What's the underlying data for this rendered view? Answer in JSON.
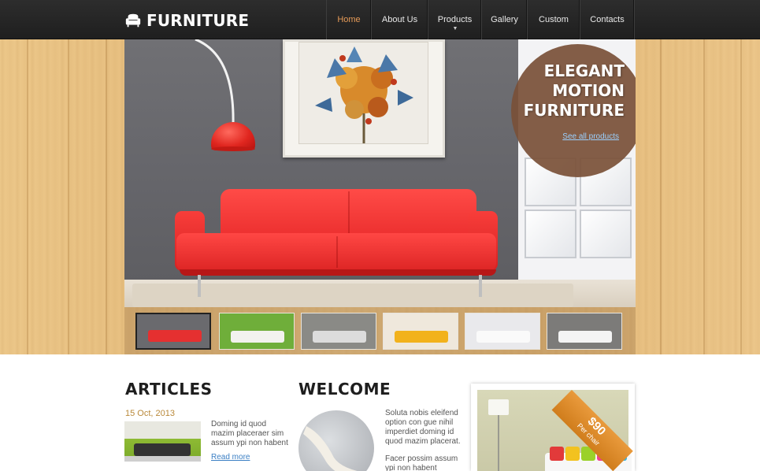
{
  "header": {
    "logo_text": "FURNITURE",
    "nav": [
      {
        "label": "Home",
        "active": true
      },
      {
        "label": "About Us",
        "active": false
      },
      {
        "label": "Products",
        "active": false,
        "has_submenu": true
      },
      {
        "label": "Gallery",
        "active": false
      },
      {
        "label": "Custom",
        "active": false
      },
      {
        "label": "Contacts",
        "active": false
      }
    ]
  },
  "hero": {
    "title_line1": "ELEGANT",
    "title_line2": "MOTION",
    "title_line3": "FURNITURE",
    "link_label": "See all products"
  },
  "thumbnails": [
    {
      "name": "red-sofa",
      "sofa_color": "#e53030",
      "bg": "#6a6a6e",
      "active": true
    },
    {
      "name": "white-sofa-green-wall",
      "sofa_color": "#f2f2ee",
      "bg": "#6fae3a",
      "active": false
    },
    {
      "name": "grey-living-room",
      "sofa_color": "#dcdcdc",
      "bg": "#8a8a86",
      "active": false
    },
    {
      "name": "yellow-sofa",
      "sofa_color": "#f2b21c",
      "bg": "#efe8dc",
      "active": false
    },
    {
      "name": "white-sofa-red-pillow",
      "sofa_color": "#fafafa",
      "bg": "#e9e9ec",
      "active": false
    },
    {
      "name": "black-white-sofa",
      "sofa_color": "#f4f4f4",
      "bg": "#7c7b79",
      "active": false
    }
  ],
  "articles": {
    "title": "ARTICLES",
    "date": "15 Oct, 2013",
    "text_lines": [
      "Doming id quod",
      "mazim placeraer sim",
      "assum ypi non habent"
    ],
    "read_more": "Read more"
  },
  "welcome": {
    "title": "WELCOME",
    "para1_lines": [
      "Soluta nobis eleifend",
      "option con gue nihil",
      "imperdiet doming id",
      "quod mazim placerat."
    ],
    "para2_lines": [
      "Facer possim assum",
      "ypi non habent"
    ]
  },
  "promo": {
    "price": "$90",
    "price_note": "Per chair"
  },
  "colors": {
    "nav_active": "#e59a57",
    "accent_orange": "#e08a2a",
    "date_gold": "#b9893a",
    "link_blue": "#3b7fc4"
  }
}
